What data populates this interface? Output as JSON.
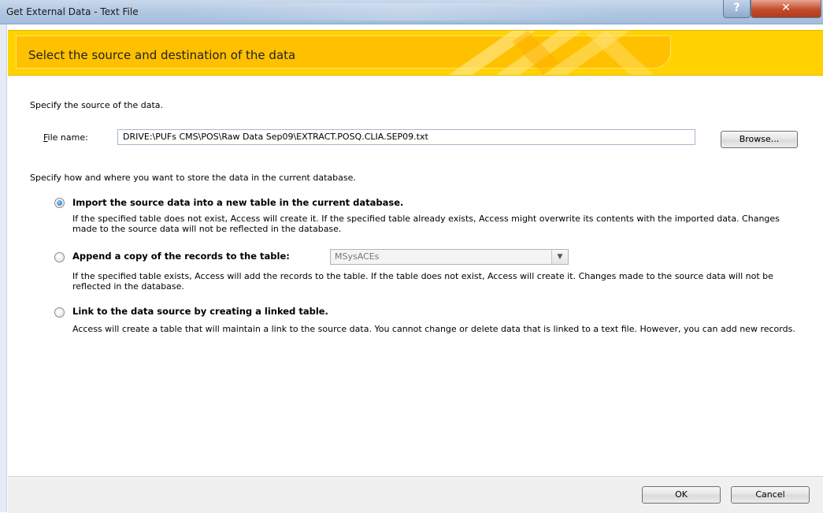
{
  "window": {
    "title": "Get External Data - Text File",
    "help_glyph": "?",
    "close_glyph": "✕"
  },
  "header": {
    "title": "Select the source and destination of the data"
  },
  "source": {
    "label": "Specify the source of the data.",
    "file_label": "File name:",
    "file_value": "DRIVE:\\PUFs CMS\\POS\\Raw Data Sep09\\EXTRACT.POSQ.CLIA.SEP09.txt",
    "browse_label": "Browse..."
  },
  "store": {
    "label": "Specify how and where you want to store the data in the current database."
  },
  "options": [
    {
      "label": "Import the source data into a new table in the current database.",
      "description": "If the specified table does not exist, Access will create it. If the specified table already exists, Access might overwrite its contents with the imported data. Changes made to the source data will not be reflected in the database.",
      "selected": true
    },
    {
      "label": "Append a copy of the records to the table:",
      "description": "If the specified table exists, Access will add the records to the table. If the table does not exist, Access will create it. Changes made to the source data will not be reflected in the database.",
      "selected": false,
      "table_value": "MSysACEs"
    },
    {
      "label": "Link to the data source by creating a linked table.",
      "description": "Access will create a table that will maintain a link to the source data. You cannot change or delete data that is linked to a text file. However, you can add new records.",
      "selected": false
    }
  ],
  "footer": {
    "ok_label": "OK",
    "cancel_label": "Cancel"
  },
  "colors": {
    "header_band": "#ffd200",
    "header_inner": "#ffc000",
    "radio_selected": "#1a67b5"
  }
}
